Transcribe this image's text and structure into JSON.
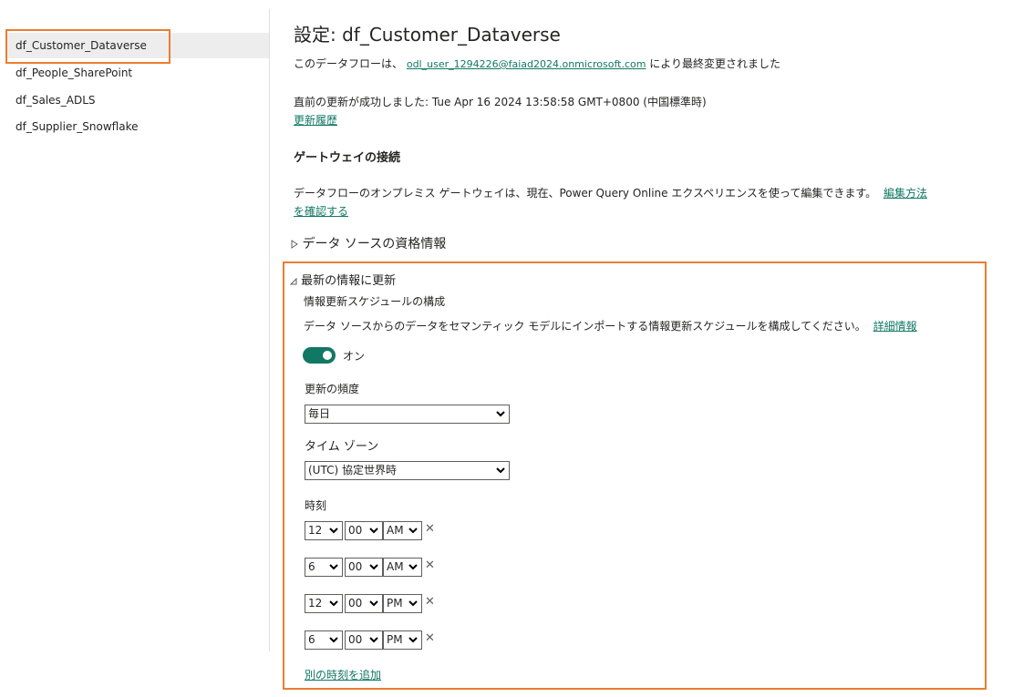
{
  "sidebar": {
    "items": [
      {
        "label": "df_Customer_Dataverse",
        "selected": true
      },
      {
        "label": "df_People_SharePoint"
      },
      {
        "label": "df_Sales_ADLS"
      },
      {
        "label": "df_Supplier_Snowflake"
      }
    ]
  },
  "header": {
    "title": "設定: df_Customer_Dataverse",
    "modified_prefix": "このデータフローは、",
    "modified_user": "odl_user_1294226@faiad2024.onmicrosoft.com",
    "modified_suffix": "により最終変更されました",
    "last_refresh": "直前の更新が成功しました: Tue Apr 16 2024 13:58:58 GMT+0800 (中国標準時)",
    "refresh_history_link": "更新履歴"
  },
  "gateway": {
    "heading": "ゲートウェイの接続",
    "text": "データフローのオンプレミス ゲートウェイは、現在、Power Query Online エクスペリエンスを使って編集できます。",
    "link_part1": "編集方法",
    "link_part2": "を確認する"
  },
  "credentials": {
    "label": "データ ソースの資格情報",
    "expand_icon": "triangle-right-icon"
  },
  "refresh": {
    "label": "最新の情報に更新",
    "expand_icon": "triangle-down-icon",
    "schedule_heading": "情報更新スケジュールの構成",
    "schedule_desc": "データ ソースからのデータをセマンティック モデルにインポートする情報更新スケジュールを構成してください。",
    "learn_more": "詳細情報",
    "toggle_label": "オン",
    "toggle_on": true,
    "frequency_label": "更新の頻度",
    "frequency_value": "毎日",
    "timezone_label": "タイム ゾーン",
    "timezone_value": "(UTC) 協定世界時",
    "time_label": "時刻",
    "times": [
      {
        "hour": "12",
        "minute": "00",
        "ampm": "AM"
      },
      {
        "hour": "6",
        "minute": "00",
        "ampm": "AM"
      },
      {
        "hour": "12",
        "minute": "00",
        "ampm": "PM"
      },
      {
        "hour": "6",
        "minute": "00",
        "ampm": "PM"
      }
    ],
    "remove_symbol": "✕",
    "add_time_link": "別の時刻を追加"
  },
  "colors": {
    "accent": "#117865",
    "highlight": "#ed7d31"
  }
}
